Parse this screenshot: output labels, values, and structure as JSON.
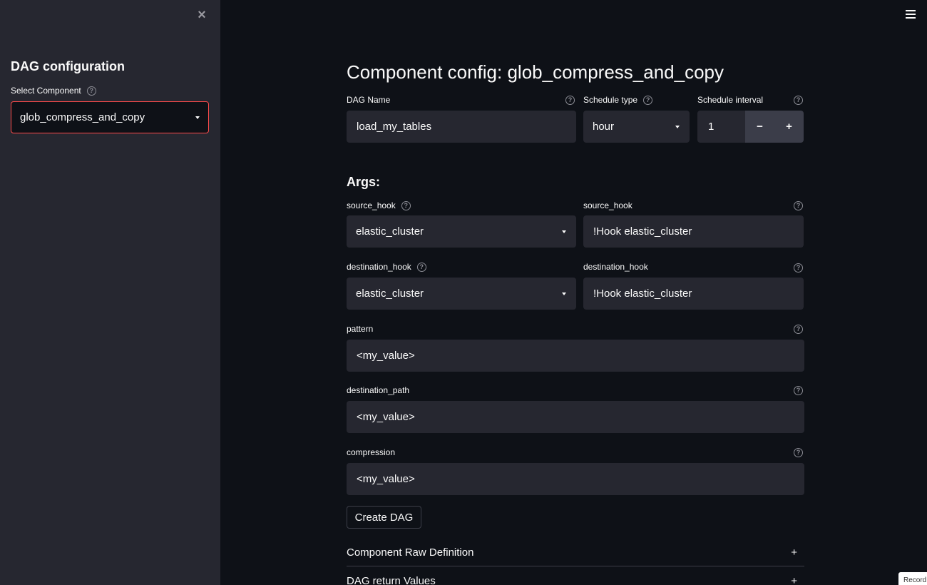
{
  "sidebar": {
    "close_icon": "×",
    "title": "DAG configuration",
    "select_label": "Select Component",
    "select_value": "glob_compress_and_copy"
  },
  "header": {
    "menu_icon": "hamburger-icon"
  },
  "main": {
    "title": "Component config: glob_compress_and_copy",
    "dag_name_label": "DAG Name",
    "dag_name_value": "load_my_tables",
    "schedule_type_label": "Schedule type",
    "schedule_type_value": "hour",
    "schedule_interval_label": "Schedule interval",
    "schedule_interval_value": "1",
    "decrement": "−",
    "increment": "+",
    "args_heading": "Args:",
    "source_hook_select_label": "source_hook",
    "source_hook_select_value": "elastic_cluster",
    "source_hook_text_label": "source_hook",
    "source_hook_text_value": "!Hook elastic_cluster",
    "destination_hook_select_label": "destination_hook",
    "destination_hook_select_value": "elastic_cluster",
    "destination_hook_text_label": "destination_hook",
    "destination_hook_text_value": "!Hook elastic_cluster",
    "pattern_label": "pattern",
    "pattern_value": "<my_value>",
    "destination_path_label": "destination_path",
    "destination_path_value": "<my_value>",
    "compression_label": "compression",
    "compression_value": "<my_value>",
    "create_button": "Create DAG",
    "expander_raw": "Component Raw Definition",
    "expander_return": "DAG return Values",
    "expander_icon": "+"
  },
  "help_glyph": "?",
  "overlay": {
    "record_badge": "Record"
  },
  "colors": {
    "app_bg": "#0e1117",
    "sidebar_bg": "#262730",
    "input_bg": "#262730",
    "focus_border": "#ff4b4b",
    "text": "#fafafa"
  }
}
